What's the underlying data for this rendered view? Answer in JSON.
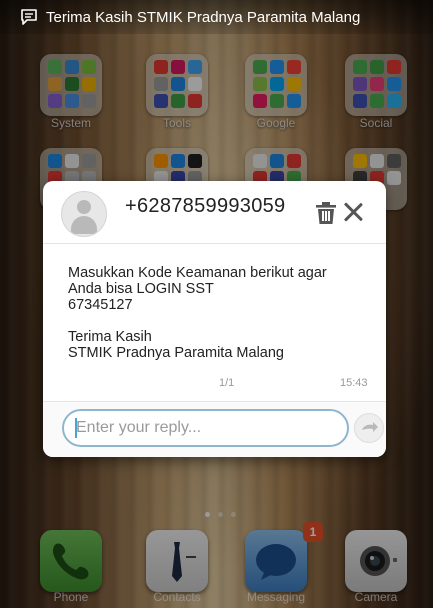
{
  "status_bar": {
    "notification_icon": "message-icon",
    "ticker_text": "Terima Kasih STMIK Pradnya Paramita Malang"
  },
  "home": {
    "folders": [
      {
        "label": "System"
      },
      {
        "label": "Tools"
      },
      {
        "label": "Google"
      },
      {
        "label": "Social"
      }
    ],
    "dock": [
      {
        "label": "Phone",
        "icon": "phone-icon"
      },
      {
        "label": "Contacts",
        "icon": "contacts-icon"
      },
      {
        "label": "Messaging",
        "icon": "messaging-icon",
        "badge": "1"
      },
      {
        "label": "Camera",
        "icon": "camera-icon"
      }
    ]
  },
  "sms_popup": {
    "sender": "+6287859993059",
    "message_lines": [
      "Masukkan Kode Keamanan berikut agar",
      "Anda bisa LOGIN SST",
      "67345127",
      "",
      "Terima Kasih",
      "STMIK Pradnya Paramita Malang"
    ],
    "counter": "1/1",
    "time": "15:43",
    "reply_placeholder": "Enter your reply...",
    "colors": {
      "accent": "#4aa3d8",
      "input_border": "#8fb6cf",
      "badge": "#e8512b"
    }
  }
}
